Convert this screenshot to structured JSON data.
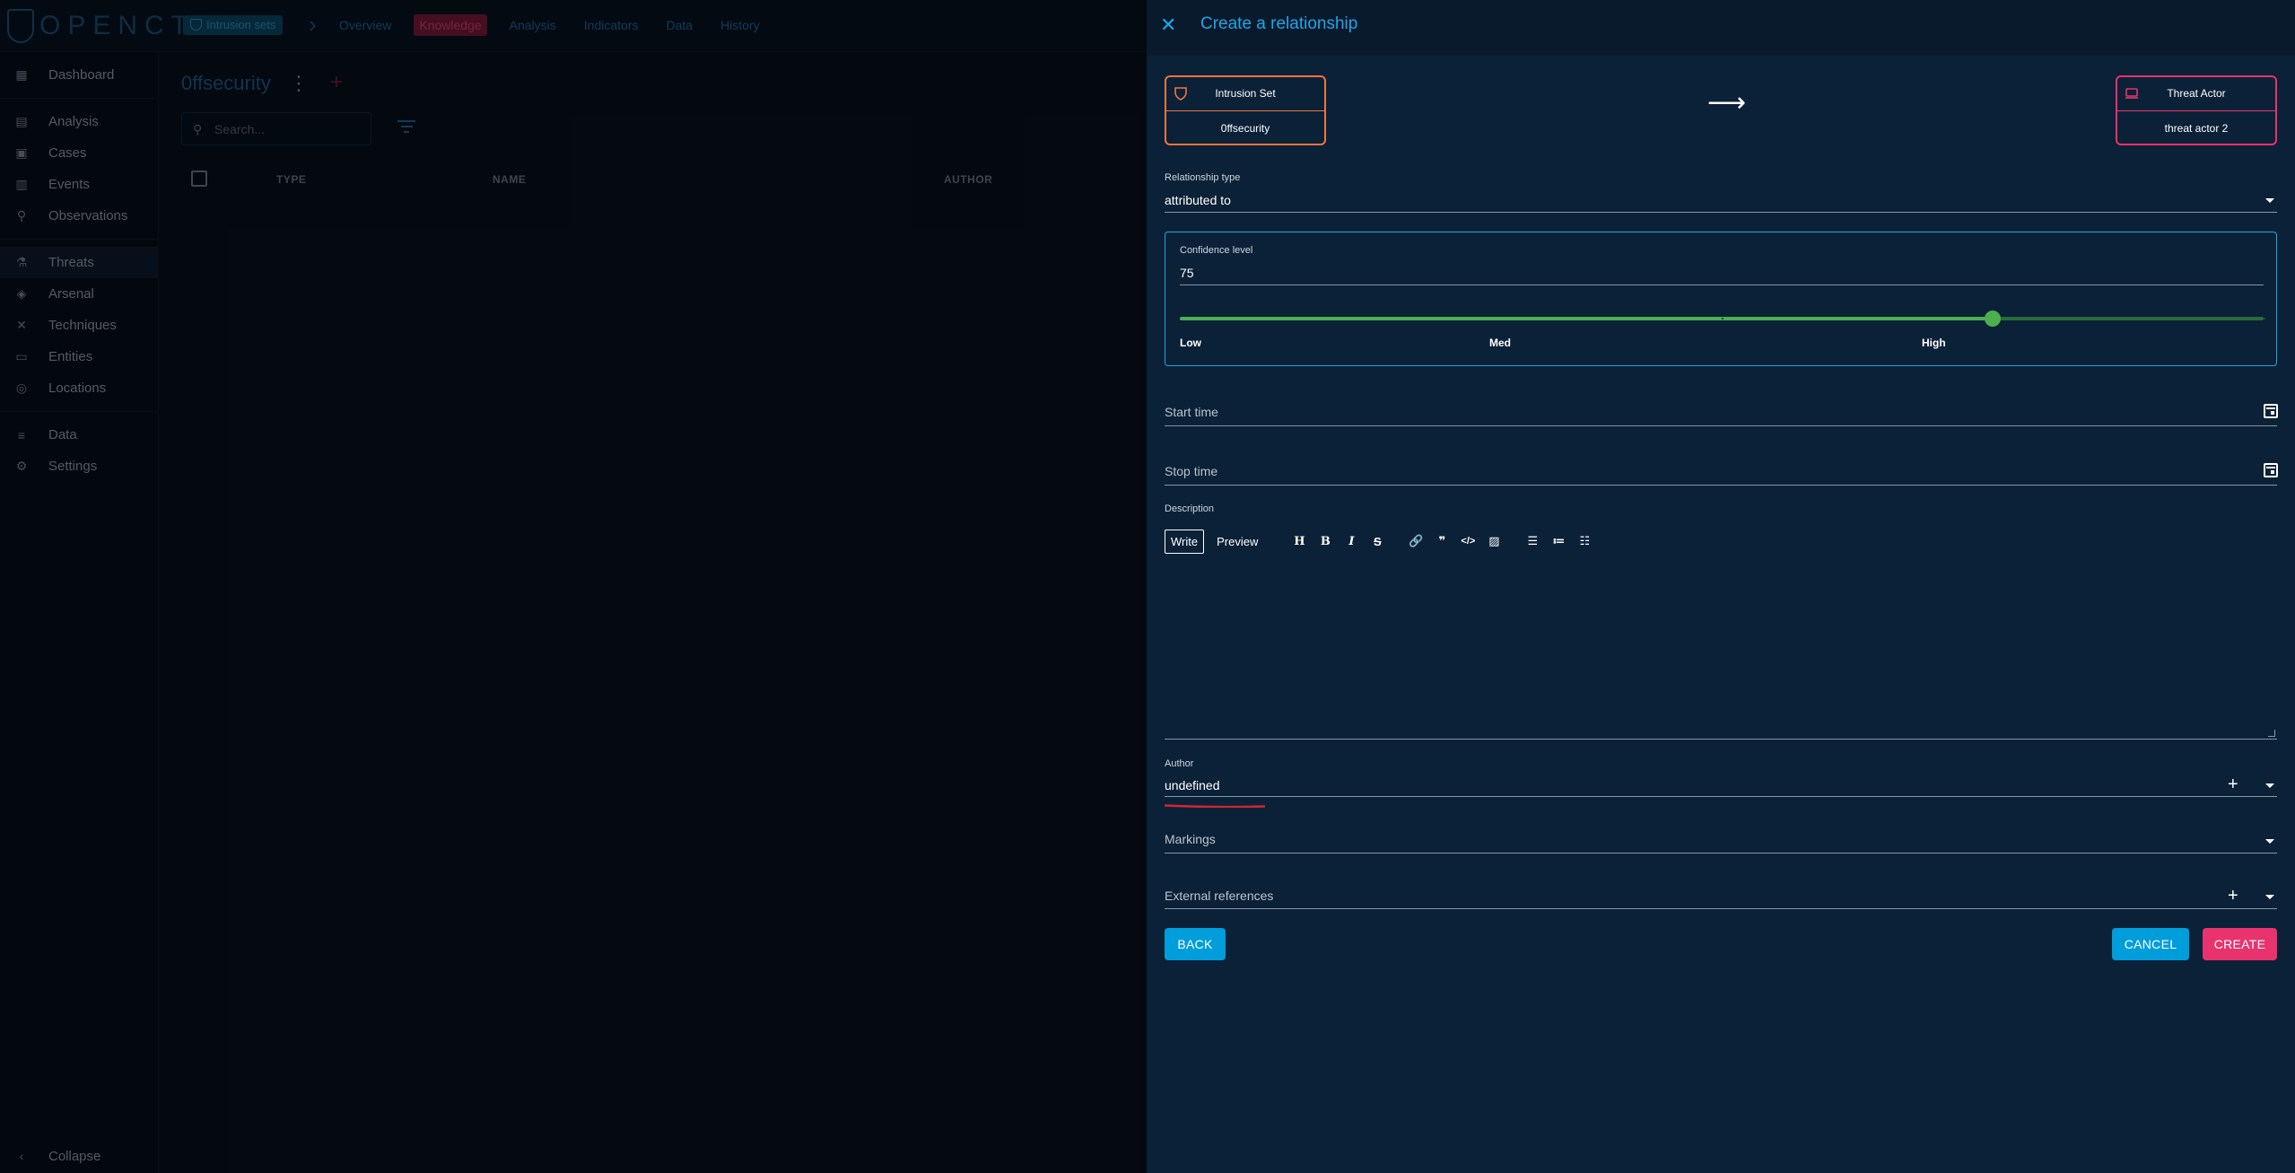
{
  "app": {
    "logo_text": "OPENCTI",
    "breadcrumb_chip": "Intrusion sets",
    "nav_tabs": [
      {
        "label": "Overview"
      },
      {
        "label": "Knowledge"
      },
      {
        "label": "Analysis"
      },
      {
        "label": "Indicators"
      },
      {
        "label": "Data"
      },
      {
        "label": "History"
      }
    ],
    "active_tab": "Knowledge"
  },
  "sidebar": {
    "items": [
      {
        "label": "Dashboard",
        "icon": "dashboard-icon"
      },
      {
        "label": "Analysis",
        "icon": "analysis-icon"
      },
      {
        "label": "Cases",
        "icon": "cases-icon"
      },
      {
        "label": "Events",
        "icon": "events-icon"
      },
      {
        "label": "Observations",
        "icon": "observations-icon"
      },
      {
        "label": "Threats",
        "icon": "threats-icon"
      },
      {
        "label": "Arsenal",
        "icon": "arsenal-icon"
      },
      {
        "label": "Techniques",
        "icon": "techniques-icon"
      },
      {
        "label": "Entities",
        "icon": "entities-icon"
      },
      {
        "label": "Locations",
        "icon": "locations-icon"
      },
      {
        "label": "Data",
        "icon": "data-icon"
      },
      {
        "label": "Settings",
        "icon": "settings-icon"
      }
    ],
    "collapse_label": "Collapse"
  },
  "content": {
    "title": "0ffsecurity",
    "search_placeholder": "Search...",
    "columns": [
      "TYPE",
      "NAME",
      "AUTHOR"
    ]
  },
  "drawer": {
    "title": "Create a relationship",
    "from": {
      "type": "Intrusion Set",
      "name": "0ffsecurity"
    },
    "to": {
      "type": "Threat Actor",
      "name": "threat actor 2"
    },
    "relationship_type": {
      "label": "Relationship type",
      "value": "attributed to"
    },
    "confidence": {
      "label": "Confidence level",
      "value": "75",
      "level_percent": 75,
      "marks": [
        "Low",
        "Med",
        "High"
      ]
    },
    "start_time_label": "Start time",
    "stop_time_label": "Stop time",
    "description": {
      "label": "Description",
      "write_tab": "Write",
      "preview_tab": "Preview"
    },
    "author": {
      "label": "Author",
      "value": "undefined"
    },
    "markings_label": "Markings",
    "external_refs_label": "External references",
    "buttons": {
      "back": "BACK",
      "cancel": "CANCEL",
      "create": "CREATE"
    }
  },
  "colors": {
    "accent": "#1ea7e4",
    "from_entity": "#f2733f",
    "to_entity": "#e8336f",
    "slider": "#4caf50",
    "create_button": "#e8336f",
    "secondary_button": "#009ddb",
    "annotation": "#d0262f"
  }
}
